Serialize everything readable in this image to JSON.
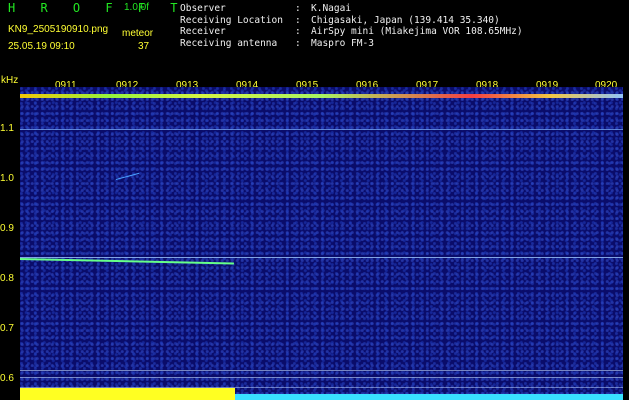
{
  "header": {
    "app_logo": "H R O F F T",
    "version": "1.0.0f",
    "filename": "KN9_2505190910.png",
    "meteor_label": "meteor",
    "datetime": "25.05.19 09:10",
    "meteor_count": "37",
    "meta": [
      {
        "key": "Observer",
        "sep": ":",
        "value": "K.Nagai"
      },
      {
        "key": "Receiving Location",
        "sep": ":",
        "value": "Chigasaki, Japan (139.414 35.340)"
      },
      {
        "key": "Receiver",
        "sep": ":",
        "value": "AirSpy mini (Miakejima VOR 108.65MHz)"
      },
      {
        "key": "Receiving antenna",
        "sep": ":",
        "value": "Maspro FM-3"
      }
    ]
  },
  "spectrogram": {
    "y_unit": "kHz",
    "time_ticks": [
      "0911",
      "0912",
      "0913",
      "0914",
      "0915",
      "0916",
      "0917",
      "0918",
      "0919",
      "0920"
    ],
    "freq_ticks": [
      "1.1",
      "1.0",
      "0.9",
      "0.8",
      "0.7",
      "0.6"
    ],
    "colors": {
      "background": "#0a0c6a",
      "label": "#ffff33",
      "accent_green": "#22e622",
      "carrier_line": "#7fb4ff",
      "meteor_trace": "#66ff88",
      "bottom_yellow": "#ffff22",
      "bottom_cyan": "#39e0ff"
    }
  }
}
